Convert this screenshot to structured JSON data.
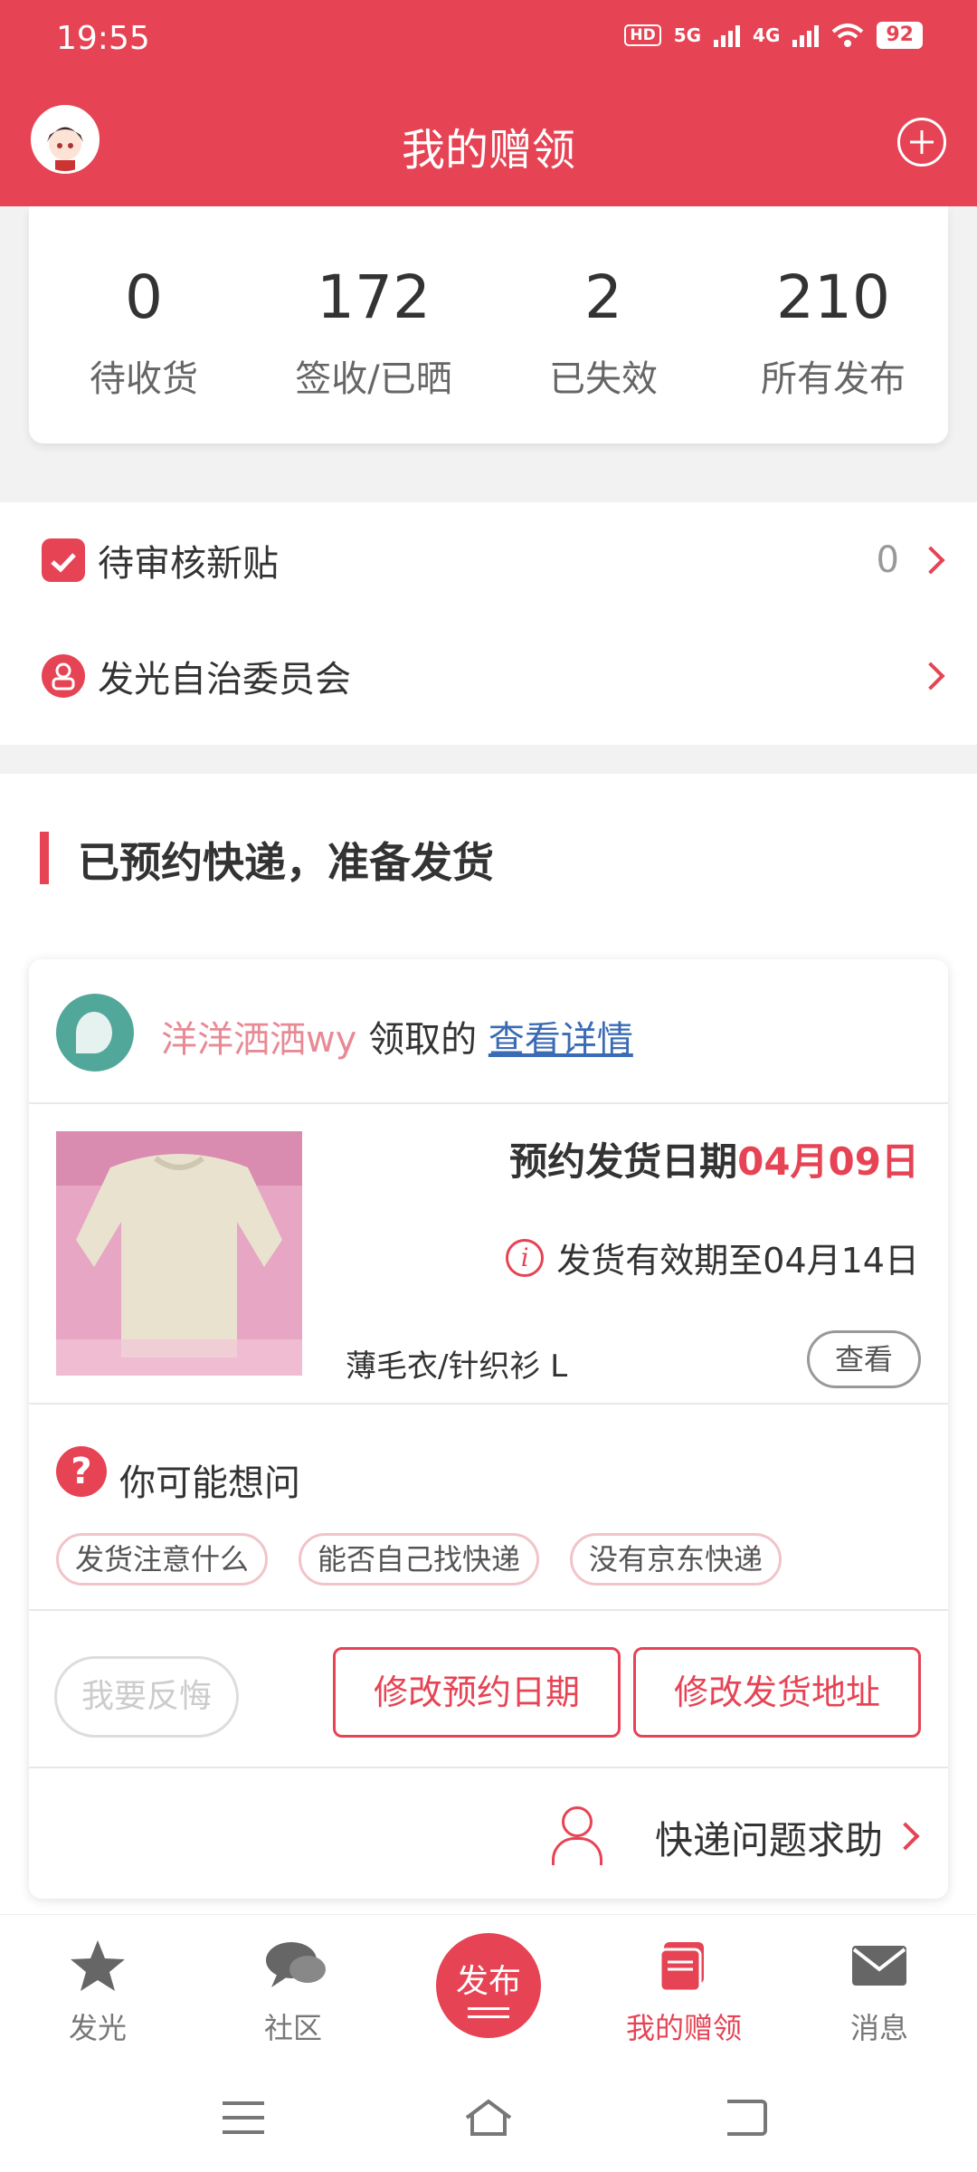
{
  "status_bar": {
    "time": "19:55",
    "network_badge": "HD",
    "sig1": "5G",
    "sig2": "4G",
    "battery": "92"
  },
  "header": {
    "title": "我的赠领",
    "avatar_icon": "avatar-icon",
    "plus_icon": "plus-circle-icon"
  },
  "stats": [
    {
      "value": "0",
      "label": "待收货"
    },
    {
      "value": "172",
      "label": "签收/已晒"
    },
    {
      "value": "2",
      "label": "已失效"
    },
    {
      "value": "210",
      "label": "所有发布"
    }
  ],
  "list": {
    "pending_review": {
      "label": "待审核新贴",
      "count": "0"
    },
    "committee": {
      "label": "发光自治委员会"
    }
  },
  "section": {
    "title": "已预约快递，准备发货"
  },
  "order": {
    "claimer": "洋洋洒洒wy",
    "claim_text": "领取的",
    "detail_link": "查看详情",
    "ship_date_label": "预约发货日期",
    "ship_date_value": "04月09日",
    "validity": "发货有效期至04月14日",
    "item_name": "薄毛衣/针织衫  L",
    "view_button": "查看",
    "faq_title": "你可能想问",
    "faq_chips": [
      "发货注意什么",
      "能否自己找快递",
      "没有京东快递"
    ],
    "regret_button": "我要反悔",
    "change_date_button": "修改预约日期",
    "change_address_button": "修改发货地址",
    "help_label": "快递问题求助"
  },
  "bottom_nav": {
    "items": [
      {
        "label": "发光",
        "icon": "star-icon"
      },
      {
        "label": "社区",
        "icon": "chat-bubble-icon"
      },
      {
        "label": "我的赠领",
        "icon": "gift-book-icon",
        "active": true
      },
      {
        "label": "消息",
        "icon": "envelope-icon"
      }
    ],
    "publish": "发布"
  },
  "colors": {
    "accent": "#e64455",
    "claimer": "#e88a95",
    "link": "#3a6bb5"
  }
}
